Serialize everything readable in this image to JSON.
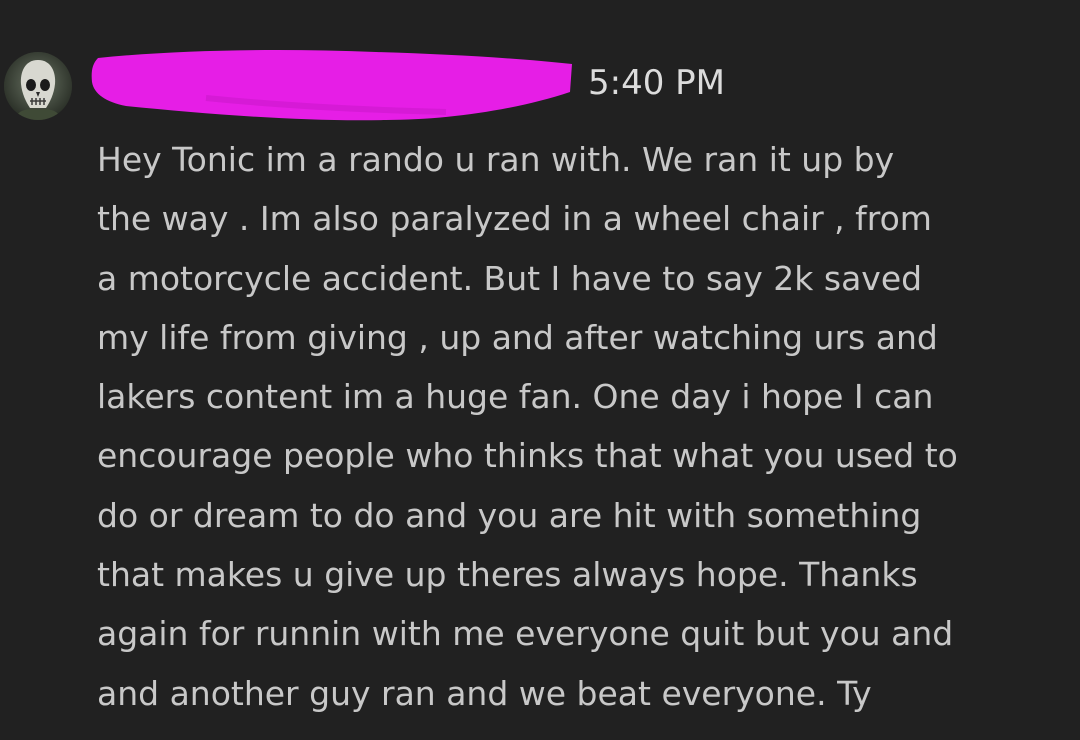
{
  "message": {
    "timestamp": "5:40 PM",
    "lines": [
      "Hey Tonic im a rando u ran with. We ran it up by",
      "the way . Im also paralyzed in a wheel chair , from",
      "a motorcycle accident. But I have to say 2k saved",
      "my life from giving , up and after watching urs and",
      "lakers content im a huge fan. One day i hope I can",
      "encourage people who thinks that what you used to",
      "do or dream to do and you are hit with something",
      "that makes u give up theres always hope. Thanks",
      "again for runnin with me everyone quit but you and",
      "and another guy ran and we beat everyone. Ty"
    ]
  },
  "colors": {
    "background": "#212121",
    "text": "#c8c8c8",
    "timestamp": "#dcdcdc",
    "redaction": "#e61ee6"
  }
}
